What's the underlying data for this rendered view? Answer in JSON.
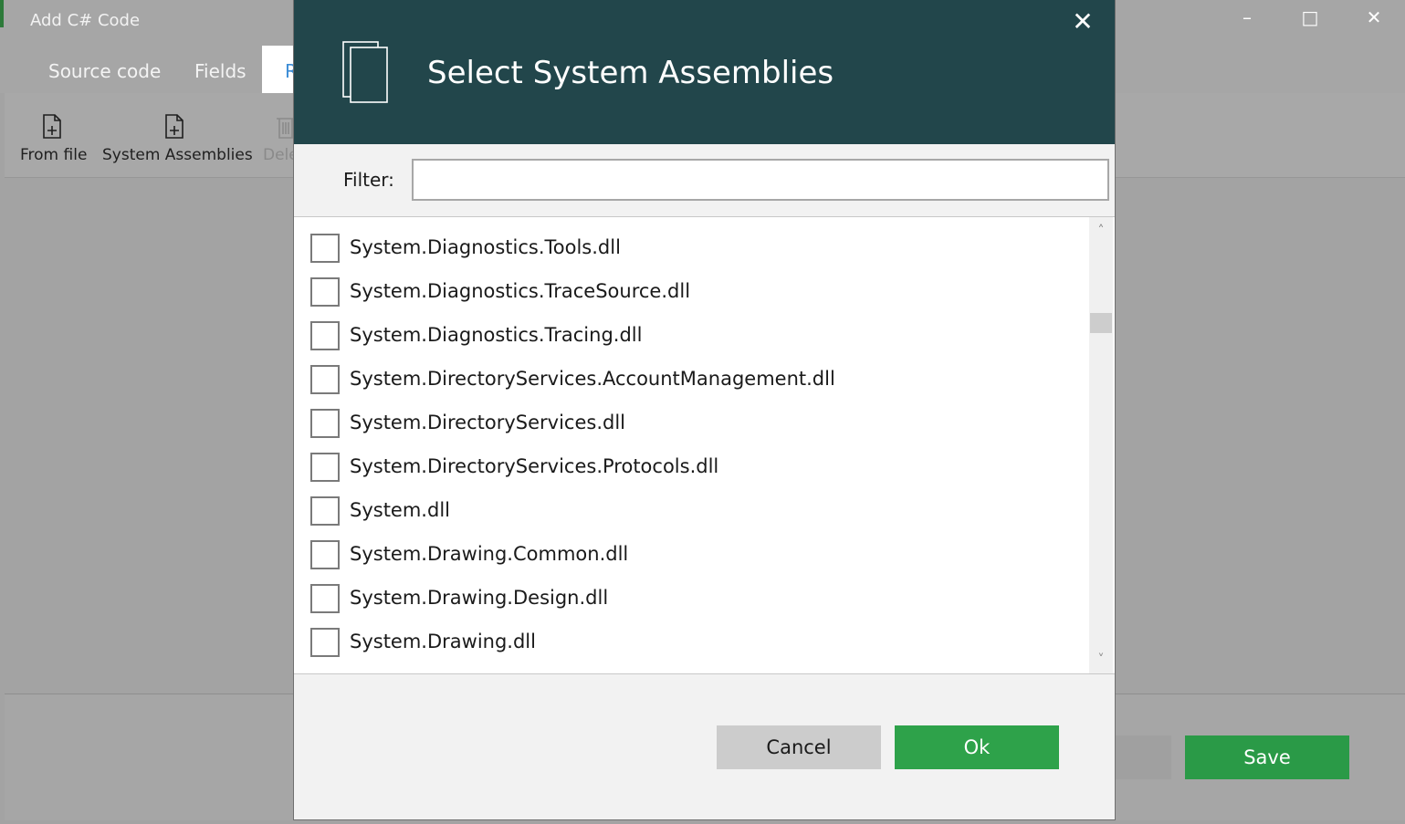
{
  "window": {
    "title": "Add C# Code",
    "controls": {
      "minimize": "–",
      "maximize": "□",
      "close": "✕"
    }
  },
  "tabs": [
    {
      "label": "Source code"
    },
    {
      "label": "Fields"
    },
    {
      "label": "R"
    }
  ],
  "toolbar": {
    "from_file": "From file",
    "system_assemblies": "System Assemblies",
    "delete": "Dele"
  },
  "footer": {
    "cancel_partial": "l",
    "save": "Save"
  },
  "dialog": {
    "title": "Select System Assemblies",
    "close": "✕",
    "filter_label": "Filter:",
    "filter_value": "",
    "items": [
      {
        "label": "System.Diagnostics.Tools.dll",
        "checked": false
      },
      {
        "label": "System.Diagnostics.TraceSource.dll",
        "checked": false
      },
      {
        "label": "System.Diagnostics.Tracing.dll",
        "checked": false
      },
      {
        "label": "System.DirectoryServices.AccountManagement.dll",
        "checked": false
      },
      {
        "label": "System.DirectoryServices.dll",
        "checked": false
      },
      {
        "label": "System.DirectoryServices.Protocols.dll",
        "checked": false
      },
      {
        "label": "System.dll",
        "checked": false
      },
      {
        "label": "System.Drawing.Common.dll",
        "checked": false
      },
      {
        "label": "System.Drawing.Design.dll",
        "checked": false
      },
      {
        "label": "System.Drawing.dll",
        "checked": false
      }
    ],
    "scroll": {
      "up": "˄",
      "down": "˅"
    },
    "cancel": "Cancel",
    "ok": "Ok"
  },
  "colors": {
    "header": "#22464b",
    "ok_green": "#2ea24a",
    "save_green": "#2a9a47"
  }
}
